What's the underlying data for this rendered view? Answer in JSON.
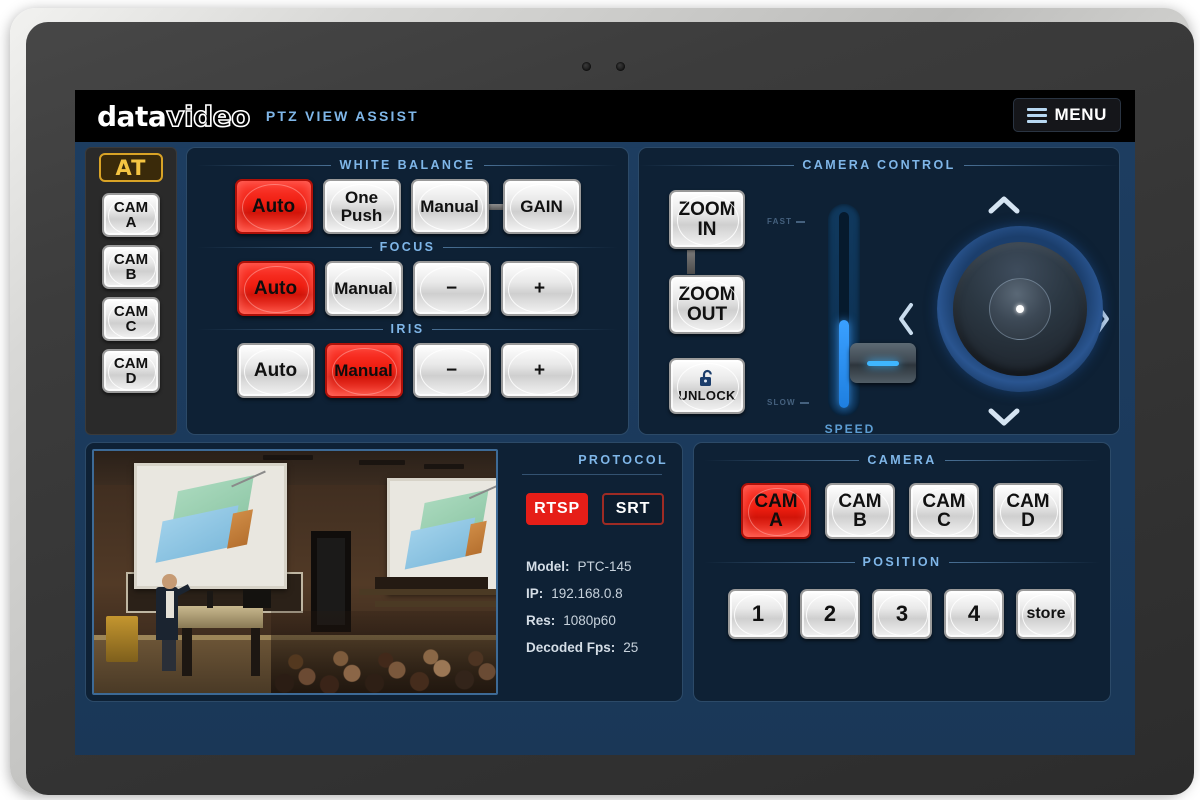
{
  "header": {
    "brand_bold": "data",
    "brand_outline": "video",
    "subtitle": "PTZ VIEW ASSIST",
    "menu_label": "MENU",
    "menu_icon": "hamburger-icon"
  },
  "sidebar": {
    "badge": "AT",
    "cameras": [
      {
        "line1": "CAM",
        "line2": "A"
      },
      {
        "line1": "CAM",
        "line2": "B"
      },
      {
        "line1": "CAM",
        "line2": "C"
      },
      {
        "line1": "CAM",
        "line2": "D"
      }
    ]
  },
  "white_balance": {
    "title": "WHITE BALANCE",
    "buttons": [
      {
        "label": "Auto",
        "active": true
      },
      {
        "label": "One Push",
        "active": false
      },
      {
        "label": "Manual",
        "active": false
      },
      {
        "label": "GAIN",
        "active": false
      }
    ]
  },
  "focus": {
    "title": "FOCUS",
    "buttons": [
      {
        "label": "Auto",
        "active": true
      },
      {
        "label": "Manual",
        "active": false
      },
      {
        "label": "−",
        "active": false
      },
      {
        "label": "+",
        "active": false
      }
    ]
  },
  "iris": {
    "title": "IRIS",
    "buttons": [
      {
        "label": "Auto",
        "active": false
      },
      {
        "label": "Manual",
        "active": true
      },
      {
        "label": "−",
        "active": false
      },
      {
        "label": "+",
        "active": false
      }
    ]
  },
  "camera_control": {
    "title": "CAMERA CONTROL",
    "zoom_in": {
      "line1": "ZOOM",
      "line2": "IN"
    },
    "zoom_out": {
      "line1": "ZOOM",
      "line2": "OUT"
    },
    "lock": {
      "label": "UNLOCK",
      "icon": "open-padlock-icon"
    },
    "speed": {
      "caption": "SPEED",
      "fast_label": "FAST",
      "slow_label": "SLOW",
      "value_percent": 42
    },
    "pan_tilt": {
      "up": "∧",
      "down": "∨",
      "left": "‹",
      "right": "›"
    }
  },
  "preview": {
    "feed_name": "lecture-hall-camera-feed"
  },
  "protocol": {
    "title": "PROTOCOL",
    "buttons": [
      {
        "label": "RTSP",
        "active": true
      },
      {
        "label": "SRT",
        "active": false
      }
    ],
    "info": [
      {
        "label": "Model:",
        "value": "PTC-145"
      },
      {
        "label": "IP:",
        "value": "192.168.0.8"
      },
      {
        "label": "Res:",
        "value": "1080p60"
      },
      {
        "label": "Decoded Fps:",
        "value": "25"
      }
    ]
  },
  "camera_select": {
    "title": "CAMERA",
    "buttons": [
      {
        "line1": "CAM",
        "line2": "A",
        "active": true
      },
      {
        "line1": "CAM",
        "line2": "B",
        "active": false
      },
      {
        "line1": "CAM",
        "line2": "C",
        "active": false
      },
      {
        "line1": "CAM",
        "line2": "D",
        "active": false
      }
    ]
  },
  "position": {
    "title": "POSITION",
    "buttons": [
      {
        "label": "1"
      },
      {
        "label": "2"
      },
      {
        "label": "3"
      },
      {
        "label": "4"
      },
      {
        "label": "store"
      }
    ]
  },
  "colors": {
    "accent_blue": "#7fb6e8",
    "active_red": "#ee1d10",
    "app_bg": "#1b3a5c",
    "panel_bg": "#0e2135",
    "badge_gold": "#f5c542"
  }
}
